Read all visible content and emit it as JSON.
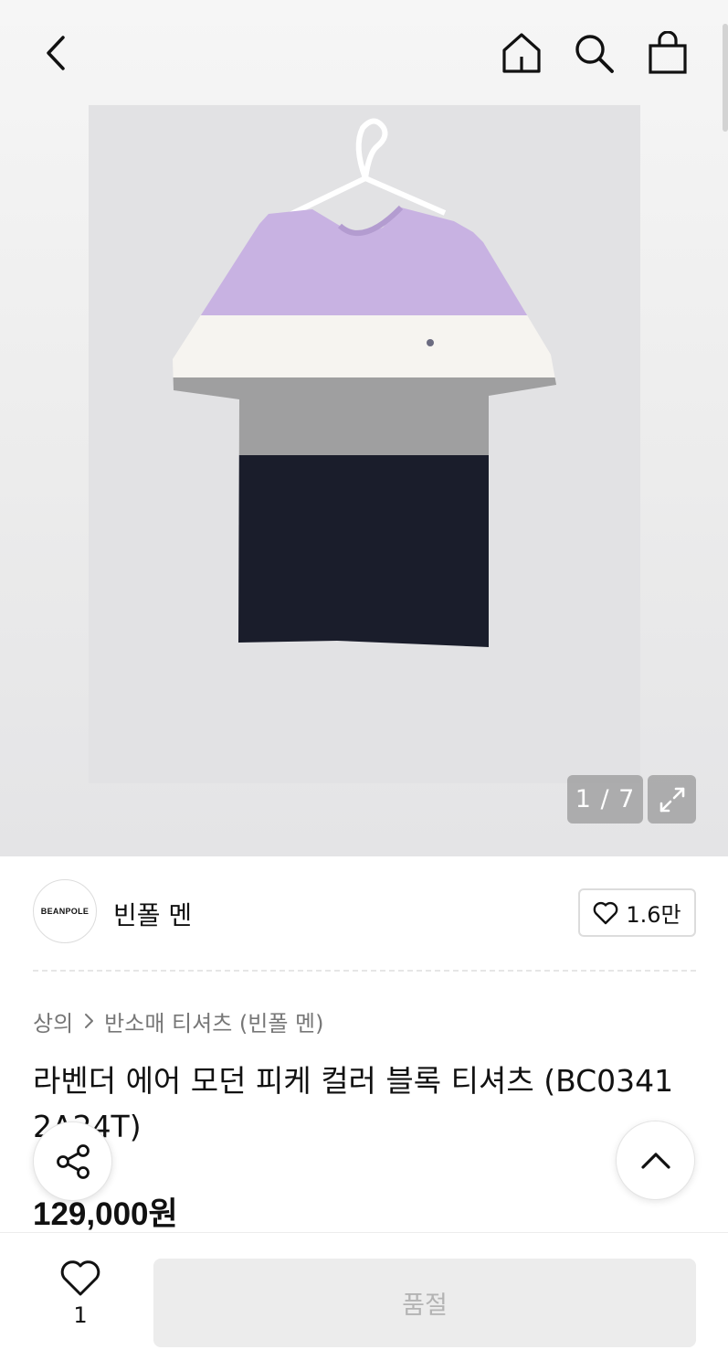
{
  "header": {
    "back_icon": "chevron-left-icon",
    "home_icon": "home-icon",
    "search_icon": "search-icon",
    "bag_icon": "shopping-bag-icon"
  },
  "gallery": {
    "counter": "1 / 7",
    "expand_icon": "expand-icon",
    "image": "striped-tshirt-product-photo",
    "stripe_colors": [
      "#c7b2e1",
      "#f6f4f0",
      "#9d9d9d",
      "#1a1d2b"
    ]
  },
  "brand": {
    "logo_text": "BEANPOLE",
    "name": "빈폴 멘",
    "like_count": "1.6만"
  },
  "breadcrumb": {
    "level1": "상의",
    "level2": "반소매 티셔츠 (빈폴 멘)"
  },
  "product": {
    "title": "라벤더 에어 모던 피케 컬러 블록 티셔츠 (BC03412A24T)",
    "price": "129,000원"
  },
  "floating": {
    "share_icon": "share-icon",
    "scroll_top_icon": "chevron-up-icon"
  },
  "bottom_bar": {
    "wish_count": "1",
    "status_button": "품절"
  }
}
